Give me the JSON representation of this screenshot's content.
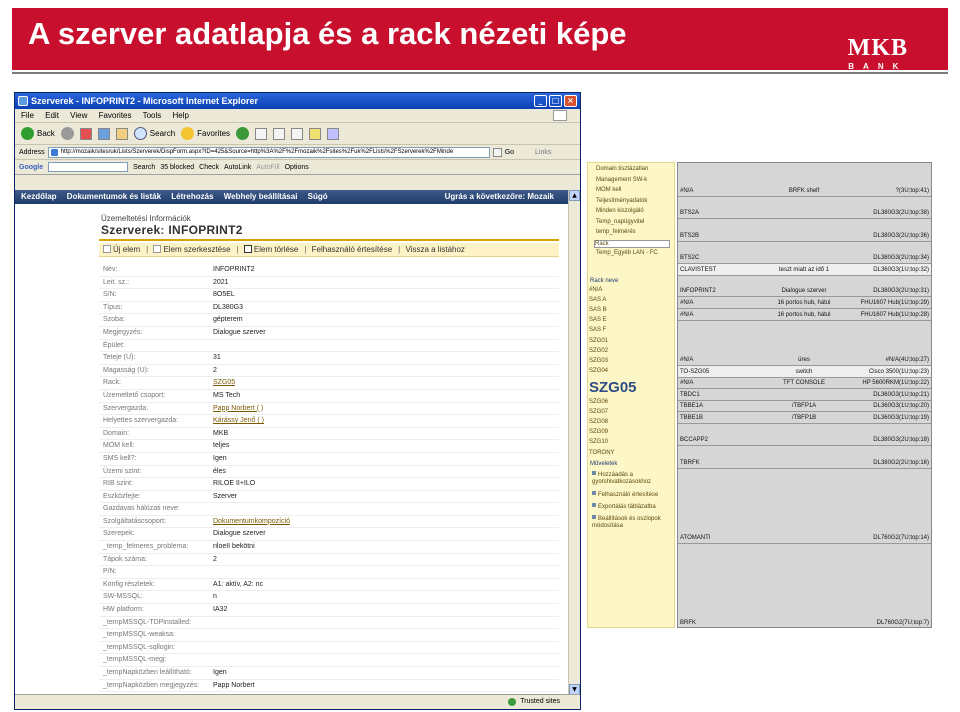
{
  "slide": {
    "title": "A szerver adatlapja és a rack nézeti képe",
    "logo_main": "MKB",
    "logo_sub": "BANK",
    "colors": {
      "title_bg": "#c8102e",
      "sp_nav": "#1f3b6b",
      "accent": "#d9a400"
    }
  },
  "browser": {
    "window_title": "Szerverek - INFOPRINT2 - Microsoft Internet Explorer",
    "menu": [
      "File",
      "Edit",
      "View",
      "Favorites",
      "Tools",
      "Help"
    ],
    "toolbar": {
      "back": "Back",
      "search": "Search",
      "favorites": "Favorites"
    },
    "address_label": "Address",
    "address_value": "http://mozaik/sites/uk/Lists/Szerverek/DispForm.aspx?ID=425&Source=http%3A%2F%2Fmozaik%2Fsites%2Fuk%2FLists%2FSzerverek%2FMinde",
    "go": "Go",
    "links": "Links",
    "google": {
      "label": "Google",
      "search": "Search",
      "blocked": "35 blocked",
      "check": "Check",
      "autolink": "AutoLink",
      "autofill": "AutoFill",
      "options": "Options"
    },
    "status_zone": "Trusted sites"
  },
  "sharepoint": {
    "nav": [
      "Kezdőlap",
      "Dokumentumok és listák",
      "Létrehozás",
      "Webhely beállításai",
      "Súgó"
    ],
    "nav_right": "Ugrás a következőre: Mozaik",
    "breadcrumb": "Üzemeltetési Információk",
    "list_name": "Szerverek",
    "item_name": "INFOPRINT2",
    "actions": [
      "Új elem",
      "Elem szerkesztése",
      "Elem törlése",
      "Felhasználó értesítése",
      "Vissza a listához"
    ],
    "fields": [
      {
        "label": "Név:",
        "value": "INFOPRINT2"
      },
      {
        "label": "Leit. sz.:",
        "value": "2021"
      },
      {
        "label": "S/N:",
        "value": "8O5EL"
      },
      {
        "label": "Típus:",
        "value": "DL380G3"
      },
      {
        "label": "Szoba:",
        "value": "gépterem"
      },
      {
        "label": "Megjegyzés:",
        "value": "Dialogue szerver"
      },
      {
        "label": "Épület:",
        "value": ""
      },
      {
        "label": "Teteje (U):",
        "value": "31"
      },
      {
        "label": "Magasság (U):",
        "value": "2"
      },
      {
        "label": "Rack:",
        "value": "SZG05",
        "link": true
      },
      {
        "label": "Üzemeltető csoport:",
        "value": "MS Tech"
      },
      {
        "label": "Szervergazda:",
        "value": "Papp Norbert (        )",
        "link": true
      },
      {
        "label": "Helyettes szervergazda:",
        "value": "Kárássy Jenő (         )",
        "link": true
      },
      {
        "label": "Domain:",
        "value": "MKB"
      },
      {
        "label": "MOM kell:",
        "value": "teljes"
      },
      {
        "label": "SMS kell?:",
        "value": "Igen"
      },
      {
        "label": "Üzemi szint:",
        "value": "éles"
      },
      {
        "label": "RIB szint:",
        "value": "RILOE II+ILO"
      },
      {
        "label": "Eszközfejte:",
        "value": "Szerver"
      },
      {
        "label": "Gazdavas hálózati neve:",
        "value": ""
      },
      {
        "label": "Szolgáltatáscsoport:",
        "value": "Dokumentumkompozíció",
        "link": true
      },
      {
        "label": "Szerepek:",
        "value": "Dialogue szerver"
      },
      {
        "label": "_temp_felmeres_problema:",
        "value": "riloeII bekötni"
      },
      {
        "label": "Tápok száma:",
        "value": "2"
      },
      {
        "label": "P/N:",
        "value": ""
      },
      {
        "label": "Konfig részletek:",
        "value": "A1: aktív, A2: nc"
      },
      {
        "label": "SW-MSSQL:",
        "value": "n"
      },
      {
        "label": "HW platform:",
        "value": "IA32"
      },
      {
        "label": "_tempMSSQL-TDPinstalled:",
        "value": ""
      },
      {
        "label": "_tempMSSQL-weaksa:",
        "value": ""
      },
      {
        "label": "_tempMSSQL-sqllogin:",
        "value": ""
      },
      {
        "label": "_tempMSSQL-megj:",
        "value": ""
      },
      {
        "label": "_tempNapközben leállítható:",
        "value": "Igen"
      },
      {
        "label": "_tempNapközben megjegyzés:",
        "value": "Papp Norbert"
      }
    ]
  },
  "rack_panel": {
    "views": [
      "Domain tisztázatlan",
      "Management SW-k",
      "MOM kell",
      "Teljesítményadatok",
      "Minden kiszolgáló",
      "Temp_napügyvitel",
      "temp_felmérés",
      "Rack",
      "Temp_Egyéb LAN - FC"
    ],
    "rack_header": "Rack neve",
    "racks": [
      "#N/A",
      "SAS A",
      "SAS B",
      "SAS E",
      "SAS F",
      "SZG01",
      "SZG02",
      "SZG03",
      "SZG04"
    ],
    "current_rack": "SZG05",
    "racks_after": [
      "SZG06",
      "SZG07",
      "SZG08",
      "SZG09",
      "SZG10",
      "TORONY"
    ],
    "actions_header": "Műveletek",
    "actions": [
      "Hozzáadás a gyorshivatkozásokhoz",
      "Felhasználó értesítése",
      "Exportálás táblázatba",
      "Beállítások és oszlopok módosítása"
    ],
    "rows": [
      {
        "c1": "#N/A",
        "c2": "BRFK shelf",
        "c3": "?(3U;top:41)"
      },
      {
        "c1": "BTS2A",
        "c2": "",
        "c3": "DL380G3(2U;top:38)"
      },
      {
        "c1": "BTS2B",
        "c2": "",
        "c3": "DL380G3(2U;top:36)"
      },
      {
        "c1": "BTS2C",
        "c2": "",
        "c3": "DL380G3(2U;top:34)"
      },
      {
        "c1": "CLAVISTEST",
        "c2": "teszt miatt az idő 1",
        "c3": "DL360G3(1U;top:32)"
      },
      {
        "c1": "INFOPRINT2",
        "c2": "Dialogue szerver",
        "c3": "DL380G3(2U;top:31)"
      },
      {
        "c1": "#N/A",
        "c2": "16 portos hub, hátul",
        "c3": "FHU1607 Hub(1U;top:29)"
      },
      {
        "c1": "#N/A",
        "c2": "16 portos hub, hátul",
        "c3": "FHU1607 Hub(1U;top:28)"
      },
      {
        "c1": "#N/A",
        "c2": "üres",
        "c3": "#N/A(4U;top:27)"
      },
      {
        "c1": "TO-SZG05",
        "c2": "switch",
        "c3": "Cisco 3500(1U;top:23)"
      },
      {
        "c1": "#N/A",
        "c2": "TFT CONSOLE",
        "c3": "HP 5600RKM(1U;top:22)"
      },
      {
        "c1": "TBDC1",
        "c2": "",
        "c3": "DL360G3(1U;top:21)"
      },
      {
        "c1": "TBBE1A",
        "c2": "/TBFP1A",
        "c3": "DL360G3(1U;top:20)"
      },
      {
        "c1": "TBBE1B",
        "c2": "/TBFP1B",
        "c3": "DL360G3(1U;top:19)"
      },
      {
        "c1": "BCCAPP2",
        "c2": "",
        "c3": "DL380G3(2U;top:18)"
      },
      {
        "c1": "TBRFK",
        "c2": "",
        "c3": "DL380G2(2U;top:16)"
      },
      {
        "c1": "ATOMANTI",
        "c2": "",
        "c3": "DL760G2(7U;top:14)"
      },
      {
        "c1": "BRFK",
        "c2": "",
        "c3": "DL760G2(7U;top:7)"
      }
    ]
  }
}
